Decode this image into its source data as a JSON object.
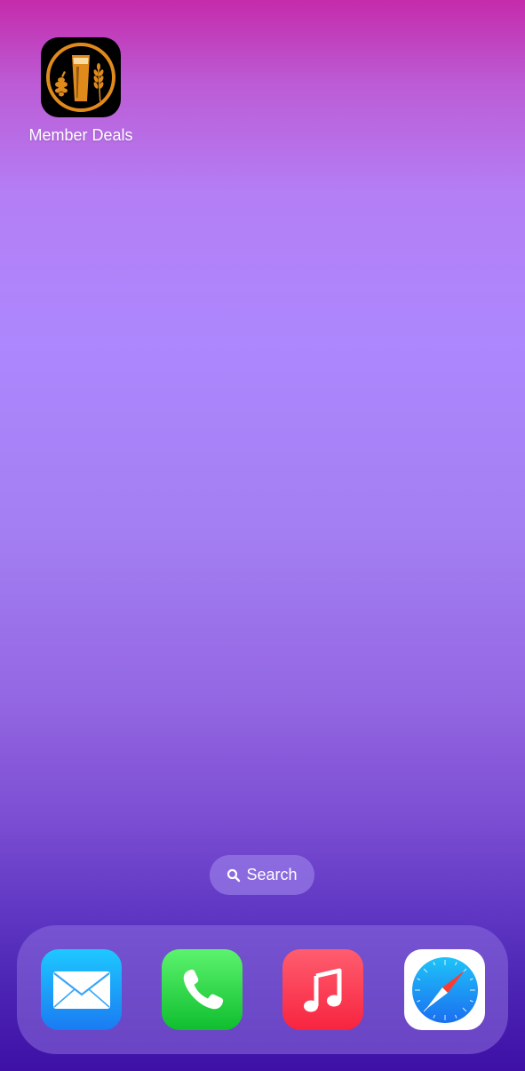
{
  "home": {
    "apps": [
      {
        "label": "Member Deals",
        "icon": "beer-glass-hops-wheat-icon"
      }
    ]
  },
  "search": {
    "label": "Search",
    "icon": "magnifying-glass-icon"
  },
  "dock": {
    "apps": [
      {
        "name": "Mail",
        "icon": "mail-icon",
        "color": "#1a8cf5"
      },
      {
        "name": "Phone",
        "icon": "phone-icon",
        "color": "#1ccc3b"
      },
      {
        "name": "Music",
        "icon": "music-note-icon",
        "color": "#fa2d48"
      },
      {
        "name": "Safari",
        "icon": "compass-icon",
        "color": "#1d8ef0"
      }
    ]
  },
  "colors": {
    "wallpaper_top": "#c42bab",
    "wallpaper_middle": "#ad87fd",
    "wallpaper_bottom": "#3e10a6"
  }
}
